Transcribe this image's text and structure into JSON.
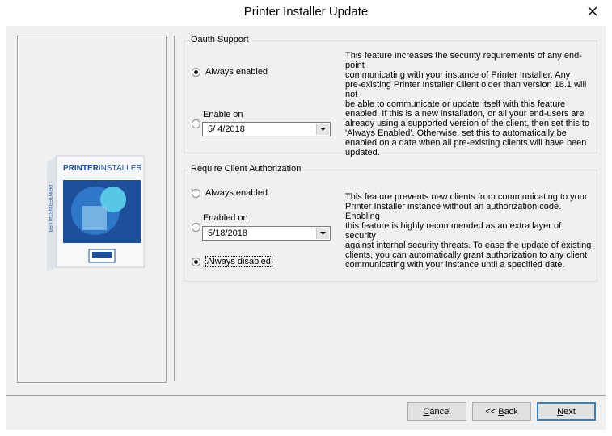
{
  "window": {
    "title": "Printer Installer Update"
  },
  "product": {
    "logo_text_bold": "PRINTER",
    "logo_text_light": "INSTALLER",
    "side_text": "PRINTERINSTALLER"
  },
  "oauth": {
    "legend": "Oauth Support",
    "always_enabled": "Always enabled",
    "enable_on": "Enable on",
    "date": "5/  4/2018",
    "selected": "always_enabled",
    "description": [
      "This feature increases the security requirements of any end-point",
      "communicating with your instance of Printer Installer.  Any",
      "pre-existing Printer Installer Client older than version 18.1 will not",
      "be able to communicate or update itself with this feature",
      "enabled.  If this is a new installation, or all your end-users are",
      "already using a supported version of the client, then set this to",
      "'Always Enabled'.  Otherwise, set this to automatically be",
      "enabled on a date when all pre-existing clients will have been",
      "updated."
    ]
  },
  "client_auth": {
    "legend": "Require Client Authorization",
    "always_enabled": "Always enabled",
    "enabled_on": "Enabled on",
    "date": "5/18/2018",
    "always_disabled": "Always disabled",
    "selected": "always_disabled",
    "description": [
      "This feature prevents new clients from communicating to your",
      "Printer Installer instance without an authorization code.  Enabling",
      "this feature is highly recommended as an extra layer of security",
      "against internal security threats.  To ease the update of existing",
      "clients, you can automatically grant authorization to any client",
      "communicating with your instance until a specified date."
    ]
  },
  "buttons": {
    "cancel_pre": "",
    "cancel_key": "C",
    "cancel_post": "ancel",
    "back_pre": "<< ",
    "back_key": "B",
    "back_post": "ack",
    "next_pre": "",
    "next_key": "N",
    "next_post": "ext"
  },
  "colors": {
    "frame_bg": "#f0f0f0",
    "button_face": "#e1e1e1",
    "default_border": "#3c7fb1"
  },
  "icons": {
    "close": "close-icon",
    "dropdown": "chevron-down-icon",
    "product": "product-box-icon"
  }
}
